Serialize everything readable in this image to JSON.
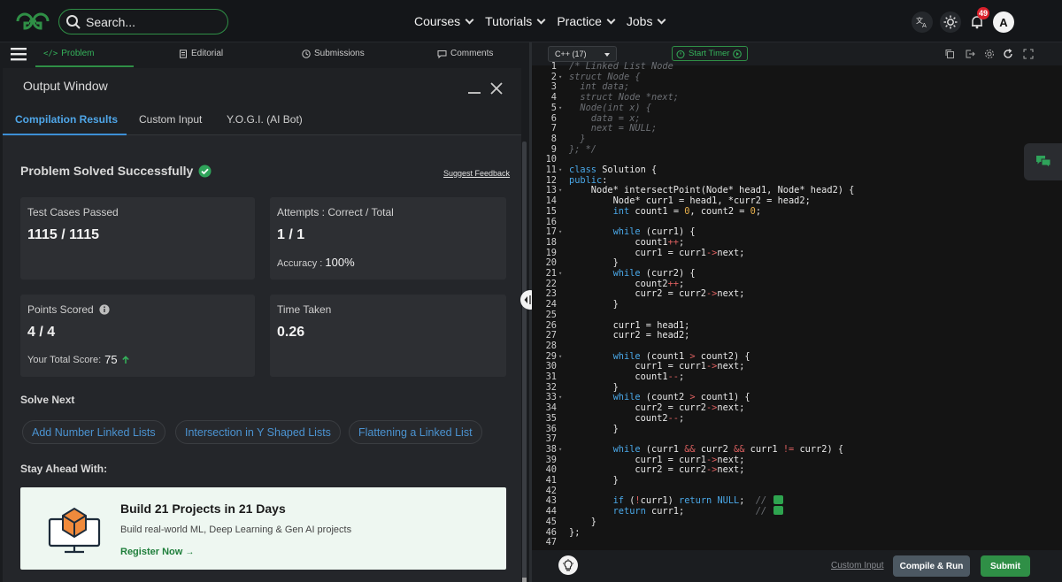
{
  "nav": {
    "search_placeholder": "Search...",
    "menu": [
      "Courses",
      "Tutorials",
      "Practice",
      "Jobs"
    ],
    "notification_count": "49",
    "avatar_letter": "A"
  },
  "left_tabs": {
    "problem": "Problem",
    "editorial": "Editorial",
    "submissions": "Submissions",
    "comments": "Comments"
  },
  "output": {
    "title": "Output Window",
    "tabs": [
      "Compilation Results",
      "Custom Input",
      "Y.O.G.I. (AI Bot)"
    ],
    "status": "Problem Solved Successfully",
    "feedback_link": "Suggest Feedback",
    "test_cases_label": "Test Cases Passed",
    "test_cases_value": "1115 / 1115",
    "attempts_label": "Attempts : Correct / Total",
    "attempts_value": "1 / 1",
    "accuracy_label": "Accuracy :",
    "accuracy_value": "100%",
    "points_label": "Points Scored",
    "points_value": "4 / 4",
    "total_score_label": "Your Total Score:",
    "total_score_value": "75",
    "time_label": "Time Taken",
    "time_value": "0.26",
    "solve_next_heading": "Solve Next",
    "solve_next": [
      "Add Number Linked Lists",
      "Intersection in Y Shaped Lists",
      "Flattening a Linked List"
    ],
    "stay_ahead_heading": "Stay Ahead With:",
    "promo_title": "Build 21 Projects in 21 Days",
    "promo_desc": "Build real-world ML, Deep Learning & Gen AI projects",
    "promo_link": "Register Now"
  },
  "editor": {
    "language": "C++ (17)",
    "timer_label": "Start Timer",
    "custom_input": "Custom Input",
    "compile_run": "Compile & Run",
    "submit": "Submit",
    "code_lines": [
      "/* Linked List Node",
      "struct Node {",
      "  int data;",
      "  struct Node *next;",
      "  Node(int x) {",
      "    data = x;",
      "    next = NULL;",
      "  }",
      "}; */",
      "",
      "class Solution {",
      "public:",
      "    Node* intersectPoint(Node* head1, Node* head2) {",
      "        Node* curr1 = head1, *curr2 = head2;",
      "        int count1 = 0, count2 = 0;",
      "",
      "        while (curr1) {",
      "            count1++;",
      "            curr1 = curr1->next;",
      "        }",
      "        while (curr2) {",
      "            count2++;",
      "            curr2 = curr2->next;",
      "        }",
      "",
      "        curr1 = head1;",
      "        curr2 = head2;",
      "",
      "        while (count1 > count2) {",
      "            curr1 = curr1->next;",
      "            count1--;",
      "        }",
      "        while (count2 > count1) {",
      "            curr2 = curr2->next;",
      "            count2--;",
      "        }",
      "",
      "        while (curr1 && curr2 && curr1 != curr2) {",
      "            curr1 = curr1->next;",
      "            curr2 = curr2->next;",
      "        }",
      "",
      "        if (!curr1) return NULL;  // ",
      "        return curr1;             // ",
      "    }",
      "};",
      ""
    ],
    "comment_lines": [
      1,
      2,
      3,
      4,
      5,
      6,
      7,
      8,
      9
    ],
    "fold_lines": [
      2,
      5,
      11,
      13,
      17,
      21,
      29,
      33,
      38
    ]
  },
  "colors": {
    "brand_green": "#2f8f46",
    "link_blue": "#4b93d1",
    "keyword": "#4aa8e8",
    "operator": "#dd6060",
    "number": "#e8b04b"
  }
}
